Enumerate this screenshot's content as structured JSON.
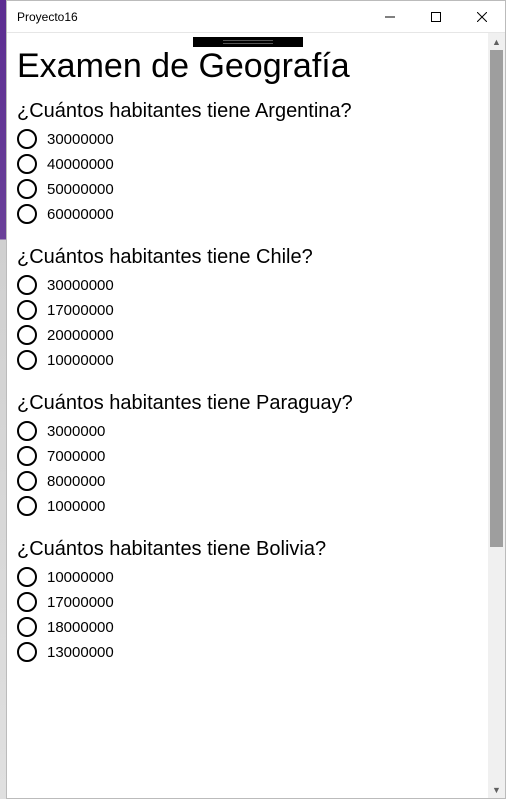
{
  "window": {
    "title": "Proyecto16"
  },
  "page": {
    "heading": "Examen de Geografía"
  },
  "questions": [
    {
      "text": "¿Cuántos habitantes tiene Argentina?",
      "options": [
        "30000000",
        "40000000",
        "50000000",
        "60000000"
      ]
    },
    {
      "text": "¿Cuántos habitantes tiene Chile?",
      "options": [
        "30000000",
        "17000000",
        "20000000",
        "10000000"
      ]
    },
    {
      "text": "¿Cuántos habitantes tiene Paraguay?",
      "options": [
        "3000000",
        "7000000",
        "8000000",
        "1000000"
      ]
    },
    {
      "text": "¿Cuántos habitantes tiene Bolivia?",
      "options": [
        "10000000",
        "17000000",
        "18000000",
        "13000000"
      ]
    }
  ]
}
